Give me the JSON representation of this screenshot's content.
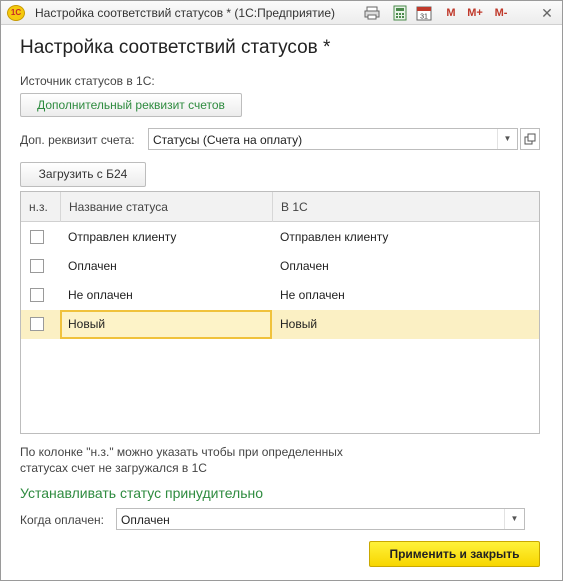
{
  "window": {
    "title": "Настройка соответствий статусов * (1С:Предприятие)",
    "app_logo": "1С",
    "toolbar_m": "M",
    "toolbar_m_plus": "M+",
    "toolbar_m_minus": "M-",
    "close_glyph": "✕",
    "calendar_day": "31"
  },
  "page": {
    "title": "Настройка соответствий статусов *"
  },
  "source": {
    "label": "Источник статусов в 1С:",
    "button_label": "Дополнительный реквизит счетов"
  },
  "attribute": {
    "label": "Доп. реквизит счета:",
    "value": "Статусы (Счета на оплату)"
  },
  "load_button": "Загрузить с Б24",
  "table": {
    "columns": [
      "н.з.",
      "Название статуса",
      "В 1С"
    ],
    "rows": [
      {
        "name": "Отправлен клиенту",
        "value_1c": "Отправлен клиенту",
        "checked": false
      },
      {
        "name": "Оплачен",
        "value_1c": "Оплачен",
        "checked": false
      },
      {
        "name": "Не оплачен",
        "value_1c": "Не оплачен",
        "checked": false
      },
      {
        "name": "Новый",
        "value_1c": "Новый",
        "checked": false
      }
    ]
  },
  "hint": {
    "line1": "По колонке \"н.з.\" можно указать чтобы при определенных",
    "line2": "статусах счет не загружался в 1С"
  },
  "force_status": {
    "title": "Устанавливать статус принудительно",
    "label": "Когда оплачен:",
    "value": "Оплачен"
  },
  "apply_button": "Применить и закрыть",
  "colors": {
    "accent_green": "#2e8b3f",
    "primary_yellow": "#f7d600",
    "selected_row": "#fbf0c4",
    "current_cell_border": "#f0c23c"
  }
}
